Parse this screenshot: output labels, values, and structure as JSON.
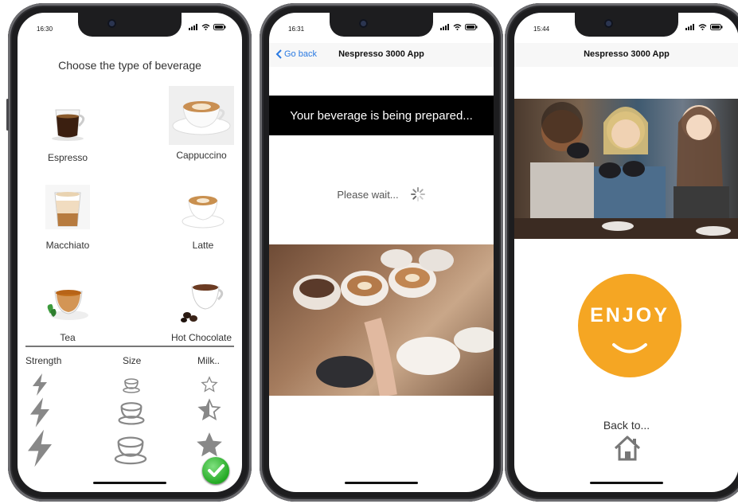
{
  "screen1": {
    "time": "16:30",
    "title": "Choose the type of beverage",
    "beverages": [
      {
        "label": "Espresso"
      },
      {
        "label": "Cappuccino"
      },
      {
        "label": "Macchiato"
      },
      {
        "label": "Latte"
      },
      {
        "label": "Tea"
      },
      {
        "label": "Hot Chocolate"
      }
    ],
    "options": {
      "strength_label": "Strength",
      "size_label": "Size",
      "milk_label": "Milk.."
    }
  },
  "screen2": {
    "time": "16:31",
    "back_label": "Go back",
    "app_title": "Nespresso 3000 App",
    "banner": "Your beverage is being prepared...",
    "wait_text": "Please wait..."
  },
  "screen3": {
    "time": "15:44",
    "app_title": "Nespresso 3000 App",
    "enjoy": "ENJOY",
    "back_to": "Back to..."
  },
  "colors": {
    "accent_blue": "#2a7ae2",
    "enjoy_orange": "#f5a623",
    "confirm_green": "#23a923"
  }
}
